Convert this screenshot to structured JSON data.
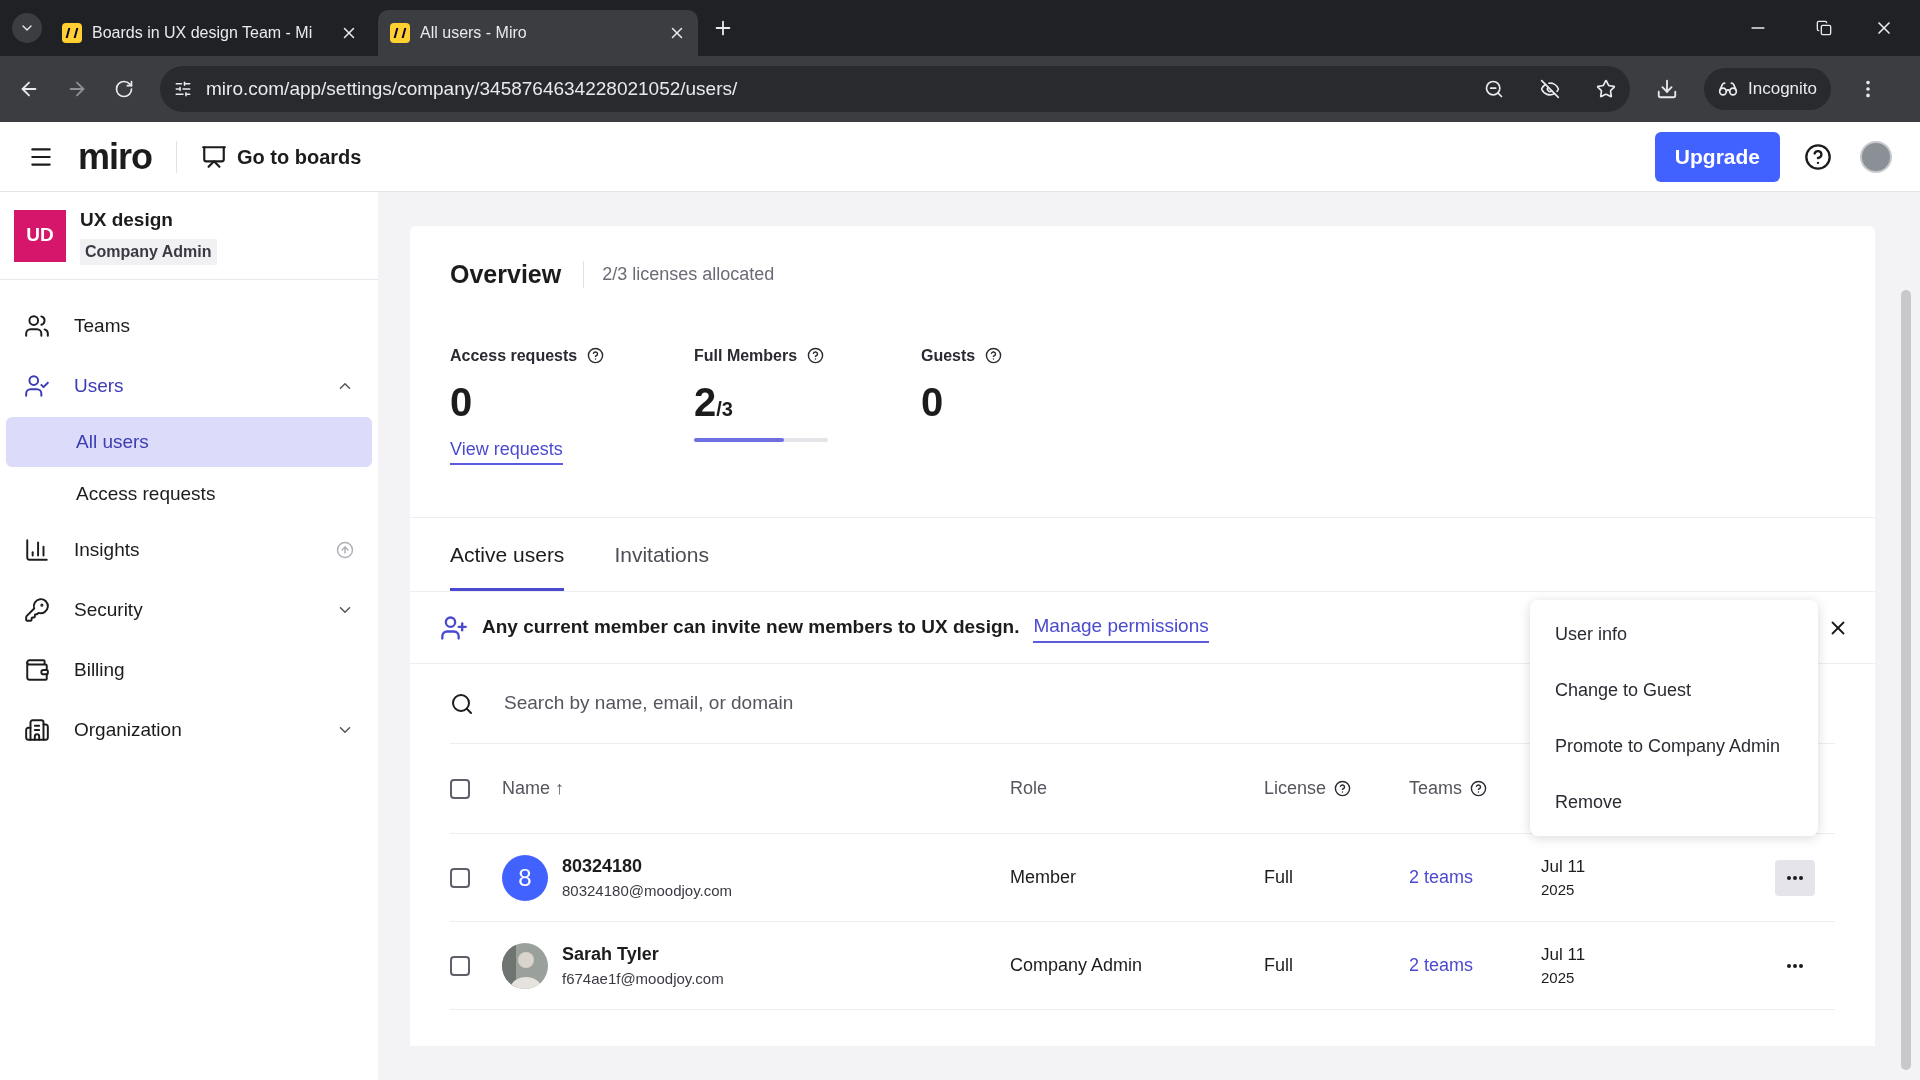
{
  "browser": {
    "tabs": [
      {
        "title": "Boards in UX design Team - Mi",
        "selected": false
      },
      {
        "title": "All users - Miro",
        "selected": true
      }
    ],
    "url": "miro.com/app/settings/company/3458764634228021052/users/",
    "incognito_label": "Incognito"
  },
  "header": {
    "logo": "miro",
    "go_to_boards": "Go to boards",
    "upgrade": "Upgrade"
  },
  "sidebar": {
    "org": {
      "initials": "UD",
      "name": "UX design",
      "role": "Company Admin"
    },
    "items": [
      {
        "kind": "item",
        "label": "Teams",
        "selected": false
      },
      {
        "kind": "group",
        "label": "Users",
        "expanded": true,
        "children": [
          {
            "label": "All users",
            "selected": true
          },
          {
            "label": "Access requests",
            "selected": false
          }
        ]
      },
      {
        "kind": "upgrade",
        "label": "Insights",
        "selected": false
      },
      {
        "kind": "group",
        "label": "Security",
        "expanded": false
      },
      {
        "kind": "item",
        "label": "Billing",
        "selected": false
      },
      {
        "kind": "group",
        "label": "Organization",
        "expanded": false
      }
    ]
  },
  "overview": {
    "title": "Overview",
    "subtitle": "2/3 licenses allocated",
    "stats": [
      {
        "kind": "plain",
        "label": "Access requests",
        "value": "0",
        "link": "View requests"
      },
      {
        "kind": "meter",
        "label": "Full Members",
        "value": "2",
        "total": "/3",
        "level": 0.67
      },
      {
        "kind": "plain",
        "label": "Guests",
        "value": "0"
      }
    ]
  },
  "tabs": [
    {
      "label": "Active users",
      "selected": true
    },
    {
      "label": "Invitations",
      "selected": false
    }
  ],
  "banner": {
    "text": "Any current member can invite new members to UX design.",
    "link": "Manage permissions"
  },
  "search": {
    "placeholder": "Search by name, email, or domain"
  },
  "table": {
    "all_checked": false,
    "columns": [
      {
        "label": "Name ↑",
        "help": false
      },
      {
        "label": "Role",
        "help": false
      },
      {
        "label": "License",
        "help": true
      },
      {
        "label": "Teams",
        "help": true
      }
    ],
    "rows": [
      {
        "kind": "initial",
        "initial": "8",
        "name": "80324180",
        "email": "80324180@moodjoy.com",
        "role": "Member",
        "license": "Full",
        "teams": "2 teams",
        "date": "Jul 11",
        "year": "2025",
        "checked": false,
        "menu_open": true
      },
      {
        "kind": "picture",
        "name": "Sarah Tyler",
        "email": "f674ae1f@moodjoy.com",
        "role": "Company Admin",
        "license": "Full",
        "teams": "2 teams",
        "date": "Jul 11",
        "year": "2025",
        "checked": false,
        "menu_open": false
      }
    ]
  },
  "menu": {
    "items": [
      "User info",
      "Change to Guest",
      "Promote to Company Admin",
      "Remove"
    ]
  }
}
